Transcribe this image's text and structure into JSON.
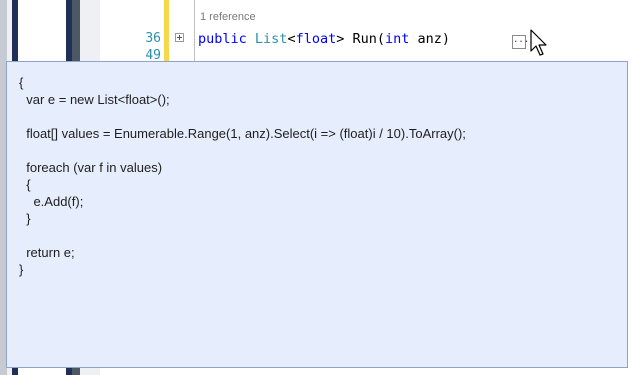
{
  "editor": {
    "reference_count": "1 reference",
    "line_numbers": [
      "36",
      "49"
    ],
    "signature": {
      "kw_public": "public",
      "type_list": "List",
      "lt": "<",
      "kw_float": "float",
      "gt_run": "> Run(",
      "kw_int": "int",
      "param": " anz)"
    },
    "collapsed_marker": "...",
    "closing_brace": "}"
  },
  "tooltip": {
    "lines": [
      "{",
      "  var e = new List<float>();",
      "",
      "  float[] values = Enumerable.Range(1, anz).Select(i => (float)i / 10).ToArray();",
      "",
      "  foreach (var f in values)",
      "  {",
      "    e.Add(f);",
      "  }",
      "",
      "  return e;",
      "}"
    ]
  },
  "colors": {
    "keyword": "#0000ff",
    "type": "#2b91af",
    "line_number": "#2b91af",
    "tooltip_bg": "#e6eefd",
    "modified_bar": "#f7d84a"
  }
}
